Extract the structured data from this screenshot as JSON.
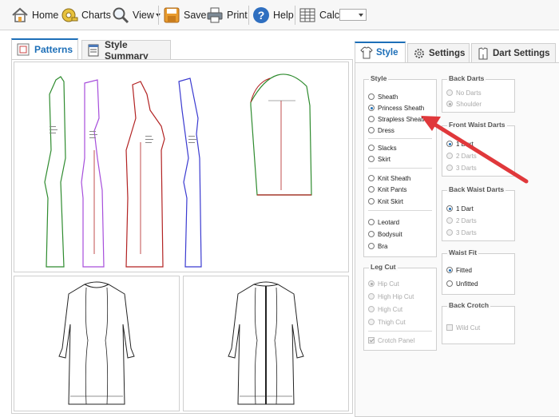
{
  "toolbar": {
    "home": "Home",
    "charts": "Charts",
    "view": "View",
    "save": "Save",
    "print": "Print",
    "help": "Help",
    "calc": "Calc:",
    "calc_value": ""
  },
  "left_tabs": [
    "Patterns",
    "Style Summary"
  ],
  "right_tabs": [
    "Style",
    "Settings",
    "Dart Settings"
  ],
  "groups": {
    "style": {
      "legend": "Style",
      "options": [
        "Sheath",
        "Princess Sheath",
        "Strapless Sheath",
        "Dress",
        "Slacks",
        "Skirt",
        "Knit Sheath",
        "Knit Pants",
        "Knit Skirt",
        "Leotard",
        "Bodysuit",
        "Bra"
      ],
      "selected": "Princess Sheath"
    },
    "back_darts": {
      "legend": "Back Darts",
      "options": [
        "No Darts",
        "Shoulder"
      ],
      "selected": "Shoulder"
    },
    "front_waist_darts": {
      "legend": "Front Waist Darts",
      "options": [
        "1 Dart",
        "2 Darts",
        "3 Darts"
      ],
      "selected": "1 Dart"
    },
    "back_waist_darts": {
      "legend": "Back Waist Darts",
      "options": [
        "1 Dart",
        "2 Darts",
        "3 Darts"
      ],
      "selected": "1 Dart"
    },
    "waist_fit": {
      "legend": "Waist Fit",
      "options": [
        "Fitted",
        "Unfitted"
      ],
      "selected": "Fitted"
    },
    "leg_cut": {
      "legend": "Leg Cut",
      "options": [
        "Hip Cut",
        "High Hip Cut",
        "High Cut",
        "Thigh Cut"
      ],
      "selected": "Hip Cut",
      "checkbox": "Crotch Panel"
    },
    "back_crotch": {
      "legend": "Back Crotch",
      "checkbox": "Wild Cut"
    }
  },
  "colors": {
    "accent": "#1d6fb8",
    "annotation_arrow": "#e0383b",
    "pattern_green": "#2e8b2e",
    "pattern_purple": "#a64ddb",
    "pattern_red": "#b22222",
    "pattern_blue": "#3a3ad0"
  }
}
